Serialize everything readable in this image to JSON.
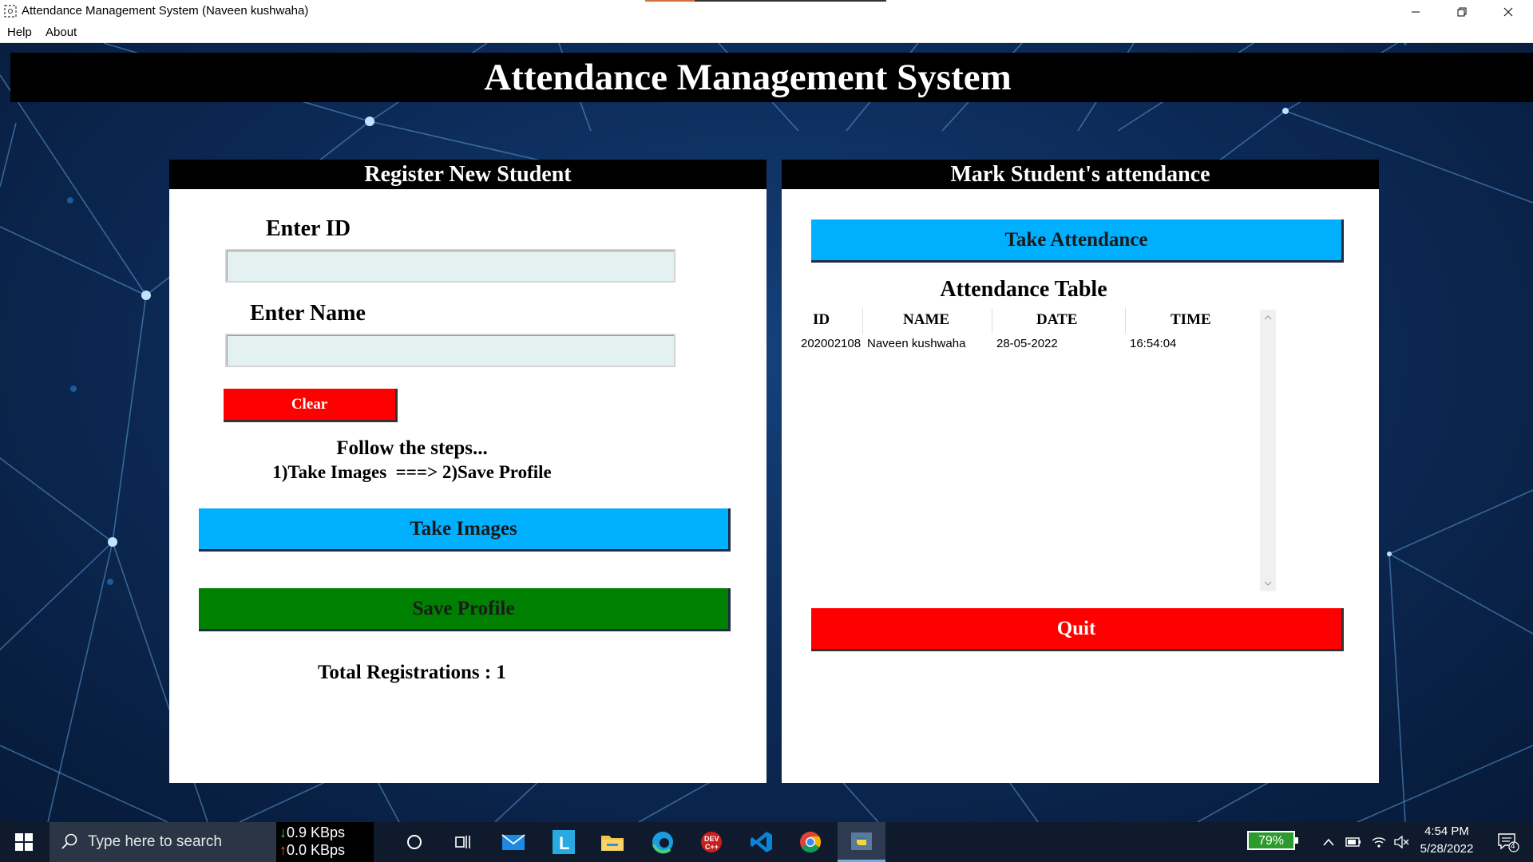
{
  "window": {
    "title": "Attendance Management System (Naveen kushwaha)"
  },
  "menu": {
    "items": [
      "Help",
      "About"
    ]
  },
  "header": {
    "title": "Attendance Management System"
  },
  "register_panel": {
    "heading": "Register New Student",
    "id_label": "Enter ID",
    "id_value": "",
    "name_label": "Enter Name",
    "name_value": "",
    "clear_label": "Clear",
    "steps_title": "Follow the steps...",
    "steps_text": "1)Take Images  ===> 2)Save Profile",
    "take_images_label": "Take Images",
    "save_profile_label": "Save Profile",
    "total_registrations": "Total Registrations : 1"
  },
  "attendance_panel": {
    "heading": "Mark Student's attendance",
    "take_attendance_label": "Take Attendance",
    "table_title": "Attendance Table",
    "columns": [
      "ID",
      "NAME",
      "DATE",
      "TIME"
    ],
    "rows": [
      [
        "202002108",
        "Naveen kushwaha",
        "28-05-2022",
        "16:54:04"
      ]
    ],
    "quit_label": "Quit"
  },
  "taskbar": {
    "search_placeholder": "Type here to search",
    "net_down": "0.9 KBps",
    "net_up": "0.0 KBps",
    "battery": "79%",
    "time": "4:54 PM",
    "date": "5/28/2022",
    "notifications": "4"
  },
  "colors": {
    "button_blue": "#00b0ff",
    "button_green": "#008000",
    "button_red": "#ff0000",
    "entry_bg": "#e4f1f1",
    "background": "#0c2a57"
  },
  "icons": [
    "windows-start-icon",
    "search-icon",
    "cortana-icon",
    "task-view-icon",
    "mail-icon",
    "l-app-icon",
    "file-explorer-icon",
    "edge-icon",
    "devcpp-icon",
    "vscode-icon",
    "chrome-icon",
    "python-icon",
    "chevron-up-icon",
    "battery-icon",
    "wifi-icon",
    "volume-muted-icon",
    "notification-icon"
  ]
}
